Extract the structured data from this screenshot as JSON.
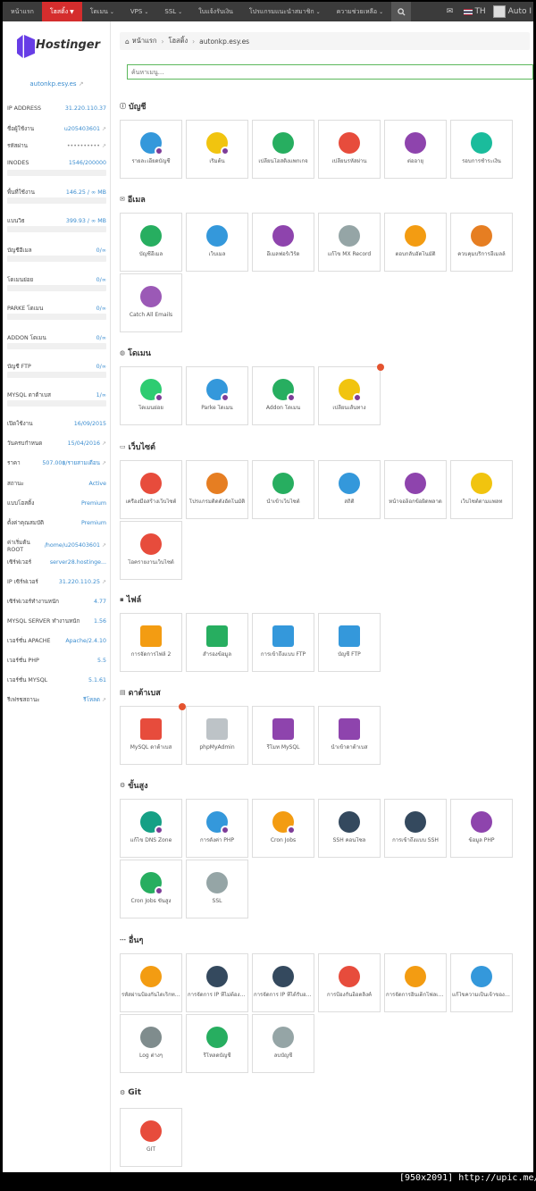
{
  "nav": {
    "items": [
      "หน้าแรก",
      "โฮสติ้ง",
      "โดเมน",
      "VPS",
      "SSL",
      "ใบแจ้งรับเงิน",
      "โปรแกรมแนะนำสมาชิก",
      "ความช่วยเหลือ"
    ],
    "active_index": 1,
    "lang": "TH",
    "user": "Auto I"
  },
  "sidebar": {
    "brand": "Hostinger",
    "domain": "autonkp.esy.es",
    "rows": [
      {
        "label": "IP ADDRESS",
        "value": "31.220.110.37"
      },
      {
        "label": "ชื่อผู้ใช้งาน",
        "value": "u205403601"
      },
      {
        "label": "รหัสผ่าน",
        "value": "••••••••••"
      },
      {
        "label": "INODES",
        "value": "1546/200000"
      },
      {
        "label": "พื้นที่ใช้งาน",
        "value": "146.25 / ∞ MB"
      },
      {
        "label": "แบนวิธ",
        "value": "399.93 / ∞ MB"
      },
      {
        "label": "บัญชีอีเมล",
        "value": "0/∞"
      },
      {
        "label": "โดเมนย่อย",
        "value": "0/∞"
      },
      {
        "label": "PARKE โดเมน",
        "value": "0/∞"
      },
      {
        "label": "ADDON โดเมน",
        "value": "0/∞"
      },
      {
        "label": "บัญชี FTP",
        "value": "0/∞"
      },
      {
        "label": "MYSQL ดาต้าเบส",
        "value": "1/∞"
      },
      {
        "label": "เปิดใช้งาน",
        "value": "16/09/2015"
      },
      {
        "label": "วันครบกำหนด",
        "value": "15/04/2016"
      },
      {
        "label": "ราคา",
        "value": "507.00฿/รายสามเดือน"
      },
      {
        "label": "สถานะ",
        "value": "Active"
      },
      {
        "label": "แบบโฮสติ้ง",
        "value": "Premium"
      },
      {
        "label": "ตั้งค่าคุณสมบัติ",
        "value": "Premium"
      },
      {
        "label": "ค่าเริ่มต้น ROOT",
        "value": "/home/u205403601"
      },
      {
        "label": "เซิร์ฟเวอร์",
        "value": "server28.hostinge..."
      },
      {
        "label": "IP เซิร์ฟเวอร์",
        "value": "31.220.110.25"
      },
      {
        "label": "เซิร์ฟเวอร์ทำงานหนัก",
        "value": "4.77"
      },
      {
        "label": "MYSQL SERVER ทำงานหนัก",
        "value": "1.56"
      },
      {
        "label": "เวอร์ชั่น APACHE",
        "value": "Apache/2.4.10"
      },
      {
        "label": "เวอร์ชั่น PHP",
        "value": "5.5"
      },
      {
        "label": "เวอร์ชั่น MYSQL",
        "value": "5.1.61"
      },
      {
        "label": "รีเฟรชสถานะ",
        "value": "รีโหลด"
      }
    ]
  },
  "breadcrumb": [
    "หน้าแรก",
    "โฮสติ้ง",
    "autonkp.esy.es"
  ],
  "search": {
    "placeholder": "ค้นหาเมนู..."
  },
  "sections": [
    {
      "title": "บัญชี",
      "tiles": [
        "รายละเอียดบัญชี",
        "เริ่มต้น",
        "เปลี่ยนโฮสติ้งแพกเกจ",
        "เปลี่ยนรหัสผ่าน",
        "ต่ออายุ",
        "รอบการชำระเงิน"
      ]
    },
    {
      "title": "อีเมล",
      "tiles": [
        "บัญชีอีเมล",
        "เว็บเมล",
        "อีเมลฟอร์เวิร์ด",
        "แก้ไข MX Record",
        "ตอบกลับอัตโนมัติ",
        "ควบคุมบริการอีเมลล์",
        "Catch All Emails"
      ]
    },
    {
      "title": "โดเมน",
      "tiles": [
        "โดเมนย่อย",
        "Parke โดเมน",
        "Addon โดเมน",
        "เปลี่ยนเส้นทาง"
      ]
    },
    {
      "title": "เว็บไซต์",
      "tiles": [
        "เครื่องมือสร้างเว็บไซต์",
        "โปรแกรมติดตั้งอัตโนมัติ",
        "นำเข้าเว็บไซต์",
        "สถิติ",
        "หน้าจอล็อกข้อผิดพลาด",
        "เว็บไซต์ตามแพลท",
        "โอครายงานเว็บไซต์"
      ]
    },
    {
      "title": "ไฟล์",
      "tiles": [
        "การจัดการไฟล์ 2",
        "สำรองข้อมูล",
        "การเข้าถึงแบบ FTP",
        "บัญชี FTP"
      ]
    },
    {
      "title": "ดาต้าเบส",
      "tiles": [
        "MySQL ดาต้าเบส",
        "phpMyAdmin",
        "รีโมท MySQL",
        "นำเข้าดาต้าเบส"
      ]
    },
    {
      "title": "ขั้นสูง",
      "tiles": [
        "แก้ไข DNS Zone",
        "การตั้งค่า PHP",
        "Cron Jobs",
        "SSH คอนโซล",
        "การเข้าถึงแบบ SSH",
        "ข้อมูล PHP",
        "Cron Jobs ขั้นสูง",
        "SSL"
      ]
    },
    {
      "title": "อื่นๆ",
      "tiles": [
        "รหัสผ่านป้องกันไดเร็กทอรี",
        "การจัดการ IP ที่ไม่ต้องการ",
        "การจัดการ IP ที่ได้รับอนุญาติ",
        "การป้องกันฮ็อตลิ้งค์",
        "การจัดการอินเด็กโฟลเดอร์",
        "แก้ไขความเป็นเจ้าของไฟล์",
        "Log ต่างๆ",
        "รีโหลดบัญชี",
        "ลบบัญชี"
      ]
    },
    {
      "title": "Git",
      "tiles": [
        "GIT"
      ]
    }
  ],
  "footer": "[950x2091] http://upic.me/"
}
